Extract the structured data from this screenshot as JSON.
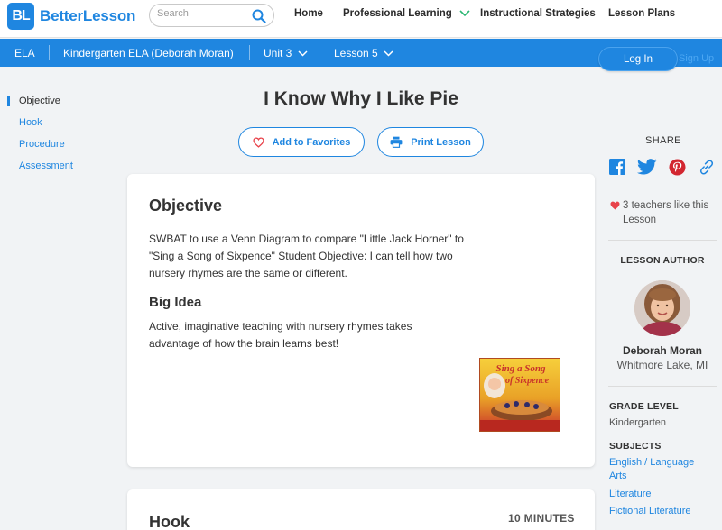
{
  "topnav": {
    "logo_mark": "BL",
    "logo_text": "BetterLesson",
    "search_placeholder": "Search",
    "links": [
      "Home",
      "Professional Learning",
      "Instructional Strategies",
      "Lesson Plans"
    ]
  },
  "breadcrumb": {
    "subject": "ELA",
    "course": "Kindergarten ELA (Deborah Moran)",
    "unit": "Unit 3",
    "lesson": "Lesson 5"
  },
  "auth": {
    "login": "Log In",
    "signup": "Sign Up"
  },
  "sidenav": [
    "Objective",
    "Hook",
    "Procedure",
    "Assessment"
  ],
  "lesson": {
    "title": "I Know Why I Like Pie",
    "add_favorites": "Add to Favorites",
    "print_lesson": "Print Lesson"
  },
  "objective_card": {
    "heading": "Objective",
    "text": "SWBAT to use a Venn Diagram to compare \"Little Jack Horner\" to \"Sing a Song of Sixpence\"  Student Objective: I can tell how two nursery rhymes are the same or different.",
    "big_idea_heading": "Big Idea",
    "big_idea_text": "Active, imaginative teaching with nursery rhymes takes advantage of how the brain learns best!",
    "book_title_line1": "Sing a Song",
    "book_title_line2": "of Sixpence"
  },
  "hook_card": {
    "heading": "Hook",
    "minutes": "10 MINUTES"
  },
  "sidebar": {
    "share_label": "SHARE",
    "share_icons": [
      "facebook-icon",
      "twitter-icon",
      "pinterest-icon",
      "link-icon"
    ],
    "likes": "3 teachers like this Lesson",
    "author_label": "LESSON AUTHOR",
    "author_name": "Deborah Moran",
    "author_location": "Whitmore Lake, MI",
    "grade_label": "GRADE LEVEL",
    "grade_value": "Kindergarten",
    "subjects_label": "SUBJECTS",
    "subjects": [
      "English / Language Arts",
      "Literature",
      "Fictional Literature"
    ]
  },
  "colors": {
    "brand_blue": "#1f86e0",
    "accent_green": "#2bb673",
    "heart_red": "#e8424a"
  }
}
